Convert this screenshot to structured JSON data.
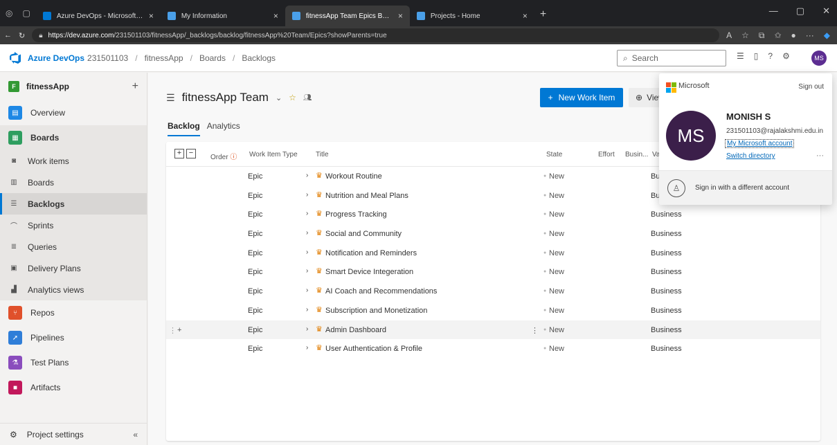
{
  "browser": {
    "tabs": [
      {
        "title": "Azure DevOps - Microsoft Azure",
        "active": false
      },
      {
        "title": "My Information",
        "active": false
      },
      {
        "title": "fitnessApp Team Epics Backlog - Bo",
        "active": true
      },
      {
        "title": "Projects - Home",
        "active": false
      }
    ],
    "url_host": "https://dev.azure.com",
    "url_path": "/231501103/fitnessApp/_backlogs/backlog/fitnessApp%20Team/Epics?showParents=true"
  },
  "header": {
    "brand": "Azure DevOps",
    "org": "231501103",
    "project": "fitnessApp",
    "section": "Boards",
    "page": "Backlogs",
    "search_placeholder": "Search",
    "avatar_initials": "MS"
  },
  "sidebar": {
    "project_name": "fitnessApp",
    "project_badge": "F",
    "items": [
      {
        "label": "Overview"
      },
      {
        "label": "Boards"
      }
    ],
    "sub_items": [
      {
        "label": "Work items"
      },
      {
        "label": "Boards"
      },
      {
        "label": "Backlogs"
      },
      {
        "label": "Sprints"
      },
      {
        "label": "Queries"
      },
      {
        "label": "Delivery Plans"
      },
      {
        "label": "Analytics views"
      }
    ],
    "more_items": [
      {
        "label": "Repos"
      },
      {
        "label": "Pipelines"
      },
      {
        "label": "Test Plans"
      },
      {
        "label": "Artifacts"
      }
    ],
    "settings_label": "Project settings"
  },
  "main": {
    "team_title": "fitnessApp Team",
    "new_work_item_label": "New Work Item",
    "view_label": "View",
    "pivots": [
      "Backlog",
      "Analytics"
    ],
    "columns": {
      "order": "Order",
      "type": "Work Item Type",
      "title": "Title",
      "state": "State",
      "effort": "Effort",
      "business": "Busin...",
      "value_area": "Va"
    },
    "rows": [
      {
        "type": "Epic",
        "title": "Workout Routine",
        "state": "New",
        "value_area": "Business"
      },
      {
        "type": "Epic",
        "title": "Nutrition and Meal Plans",
        "state": "New",
        "value_area": "Business"
      },
      {
        "type": "Epic",
        "title": "Progress Tracking",
        "state": "New",
        "value_area": "Business"
      },
      {
        "type": "Epic",
        "title": "Social and Community",
        "state": "New",
        "value_area": "Business"
      },
      {
        "type": "Epic",
        "title": "Notification and Reminders",
        "state": "New",
        "value_area": "Business"
      },
      {
        "type": "Epic",
        "title": "Smart Device Integeration",
        "state": "New",
        "value_area": "Business"
      },
      {
        "type": "Epic",
        "title": "AI Coach and Recommendations",
        "state": "New",
        "value_area": "Business"
      },
      {
        "type": "Epic",
        "title": "Subscription and Monetization",
        "state": "New",
        "value_area": "Business"
      },
      {
        "type": "Epic",
        "title": "Admin Dashboard",
        "state": "New",
        "value_area": "Business"
      },
      {
        "type": "Epic",
        "title": "User Authentication & Profile",
        "state": "New",
        "value_area": "Business"
      }
    ]
  },
  "account": {
    "provider": "Microsoft",
    "sign_out": "Sign out",
    "initials": "MS",
    "name": "MONISH S",
    "email": "231501103@rajalakshmi.edu.in",
    "my_account": "My Microsoft account",
    "switch_directory": "Switch directory",
    "different_account": "Sign in with a different account"
  },
  "colors": {
    "accent": "#0078d4",
    "avatar": "#5c2d91",
    "epic_icon": "#e07c00"
  }
}
